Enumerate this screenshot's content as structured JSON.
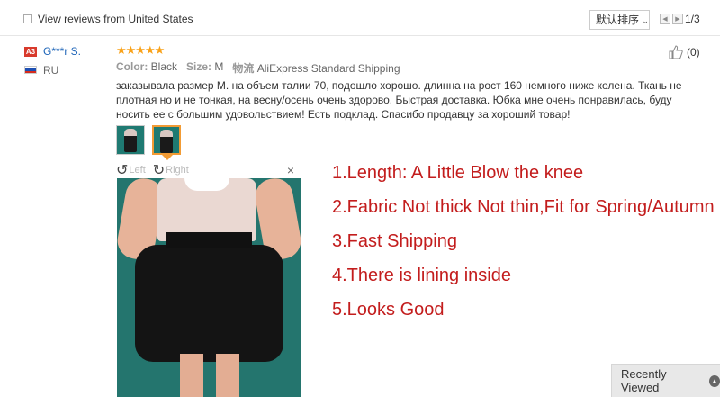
{
  "filter": {
    "label": "View reviews from United States",
    "checked": false
  },
  "sort": {
    "label": "默认排序"
  },
  "pager": {
    "text": "1/3"
  },
  "reviewer": {
    "badge": "A3",
    "name": "G***r S.",
    "country": "RU"
  },
  "review": {
    "rating": 5,
    "stars": "★★★★★",
    "color_label": "Color:",
    "color_value": "Black",
    "size_label": "Size:",
    "size_value": "M",
    "shipping_label": "物流",
    "shipping_value": "AliExpress Standard Shipping",
    "likes": "(0)",
    "text": "заказывала размер M. на объем талии 70, подошло хорошо. длинна на рост 160 немного ниже колена. Ткань не плотная но и не тонкая, на весну/осень очень здорово. Быстрая доставка. Юбка мне очень понравилась, буду носить ее с большим удовольствием! Есть подклад. Спасибо продавцу за хороший товар!"
  },
  "viewer": {
    "left_label": "Left",
    "right_label": "Right",
    "close": "×"
  },
  "notes": [
    "1.Length: A Little Blow the knee",
    "2.Fabric  Not thick Not thin,Fit for Spring/Autumn",
    "3.Fast Shipping",
    "4.There is lining inside",
    "5.Looks Good"
  ],
  "recently_viewed": {
    "label": "Recently Viewed"
  },
  "colors": {
    "accent": "#c31d1d",
    "link": "#1e65b8",
    "star": "#f9a21a",
    "thumb_active": "#f29b34"
  },
  "icons": [
    "checkbox",
    "chevron-down-icon",
    "prev-page-icon",
    "next-page-icon",
    "thumbs-up-icon",
    "rotate-left-icon",
    "rotate-right-icon",
    "close-icon",
    "chevron-up-icon"
  ]
}
